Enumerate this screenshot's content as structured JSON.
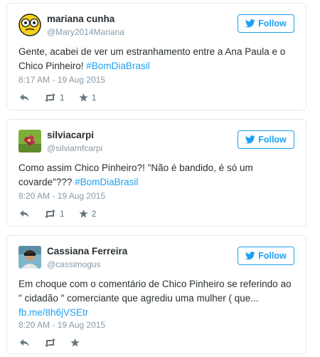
{
  "tweets": [
    {
      "name": "mariana cunha",
      "handle": "@Mary2014Mariana",
      "follow_label": "Follow",
      "text_plain": "Gente, acabei de ver um estranhamento entre a Ana Paula e o Chico Pinheiro! ",
      "hashtag": "#BomDiaBrasil",
      "timestamp": "8:17 AM - 19 Aug 2015",
      "retweets": "1",
      "favorites": "1",
      "avatar_icon": "yellow-face-emoji"
    },
    {
      "name": "silviacarpi",
      "handle": "@silviamfcarpi",
      "follow_label": "Follow",
      "text_plain": "Como assim Chico Pinheiro?! \"Não é bandido, é só um covarde\"??? ",
      "hashtag": "#BomDiaBrasil",
      "timestamp": "8:20 AM - 19 Aug 2015",
      "retweets": "1",
      "favorites": "2",
      "avatar_icon": "flower-photo"
    },
    {
      "name": "Cassiana Ferreira",
      "handle": "@cassimogus",
      "follow_label": "Follow",
      "text_plain": "Em choque com o comentário de Chico Pinheiro se referindo ao \" cidadão \" comerciante que agrediu uma mulher ( que... ",
      "link": "fb.me/8h6jVSEtr",
      "timestamp": "8:20 AM - 19 Aug 2015",
      "retweets": "",
      "favorites": "",
      "avatar_icon": "person-photo"
    }
  ],
  "colors": {
    "accent": "#1da1f2",
    "border": "#e1e8ed",
    "muted": "#8899a6",
    "text": "#292f33"
  }
}
